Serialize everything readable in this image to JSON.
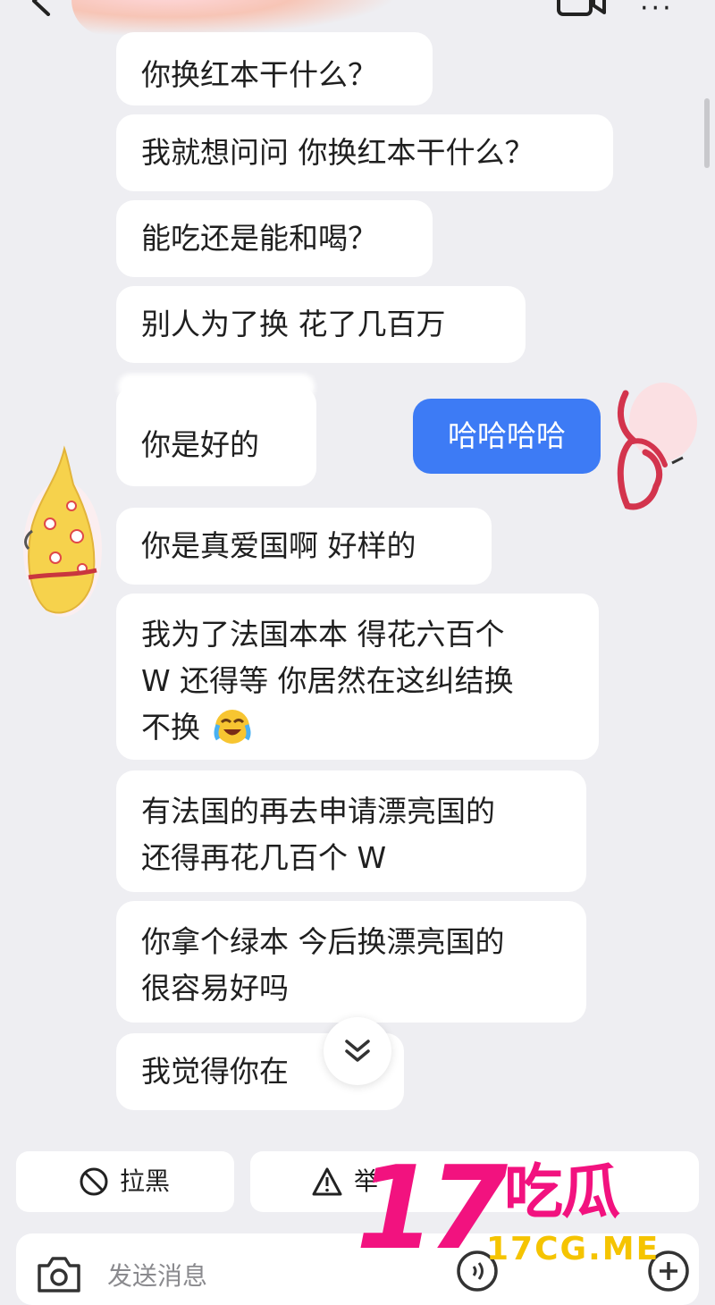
{
  "header": {
    "back_icon": "chevron-left-icon",
    "video_icon": "video-call-icon",
    "more_icon": "more-dots-icon",
    "more_glyph": "···"
  },
  "messages": [
    {
      "text": "你换红本干什么？"
    },
    {
      "text": "我就想问问 你换红本干什么？"
    },
    {
      "text": "能吃还是能和喝？"
    },
    {
      "text": "别人为了换 花了几百万"
    },
    {
      "text": "你是好的"
    },
    {
      "text": "哈哈哈哈",
      "mine": true
    },
    {
      "text": "你是真爱国啊 好样的"
    },
    {
      "lines": [
        "我为了法国本本 得花六百个",
        "W 还得等 你居然在这纠结换",
        "不换"
      ],
      "emoji": "crying-laughing-emoji"
    },
    {
      "lines": [
        "有法国的再去申请漂亮国的",
        "还得再花几百个 W"
      ]
    },
    {
      "lines": [
        "你拿个绿本 今后换漂亮国的",
        "很容易好吗"
      ]
    },
    {
      "text": "我觉得你在"
    }
  ],
  "scroll_down_icon": "double-chevron-down-icon",
  "actions": {
    "block": {
      "label": "拉黑",
      "icon": "block-icon"
    },
    "report": {
      "label": "举",
      "icon": "warning-icon"
    }
  },
  "composer": {
    "placeholder": "发送消息",
    "camera_icon": "camera-icon",
    "voice_icon": "voice-icon",
    "plus_icon": "plus-icon"
  },
  "watermark": {
    "number": "17",
    "name": "吃瓜",
    "domain": "17CG.ME"
  },
  "colors": {
    "background": "#eeeef2",
    "bubble": "#ffffff",
    "my_bubble": "#3d7bf5",
    "watermark_pink": "#f2127f",
    "watermark_yellow": "#f5c400"
  }
}
